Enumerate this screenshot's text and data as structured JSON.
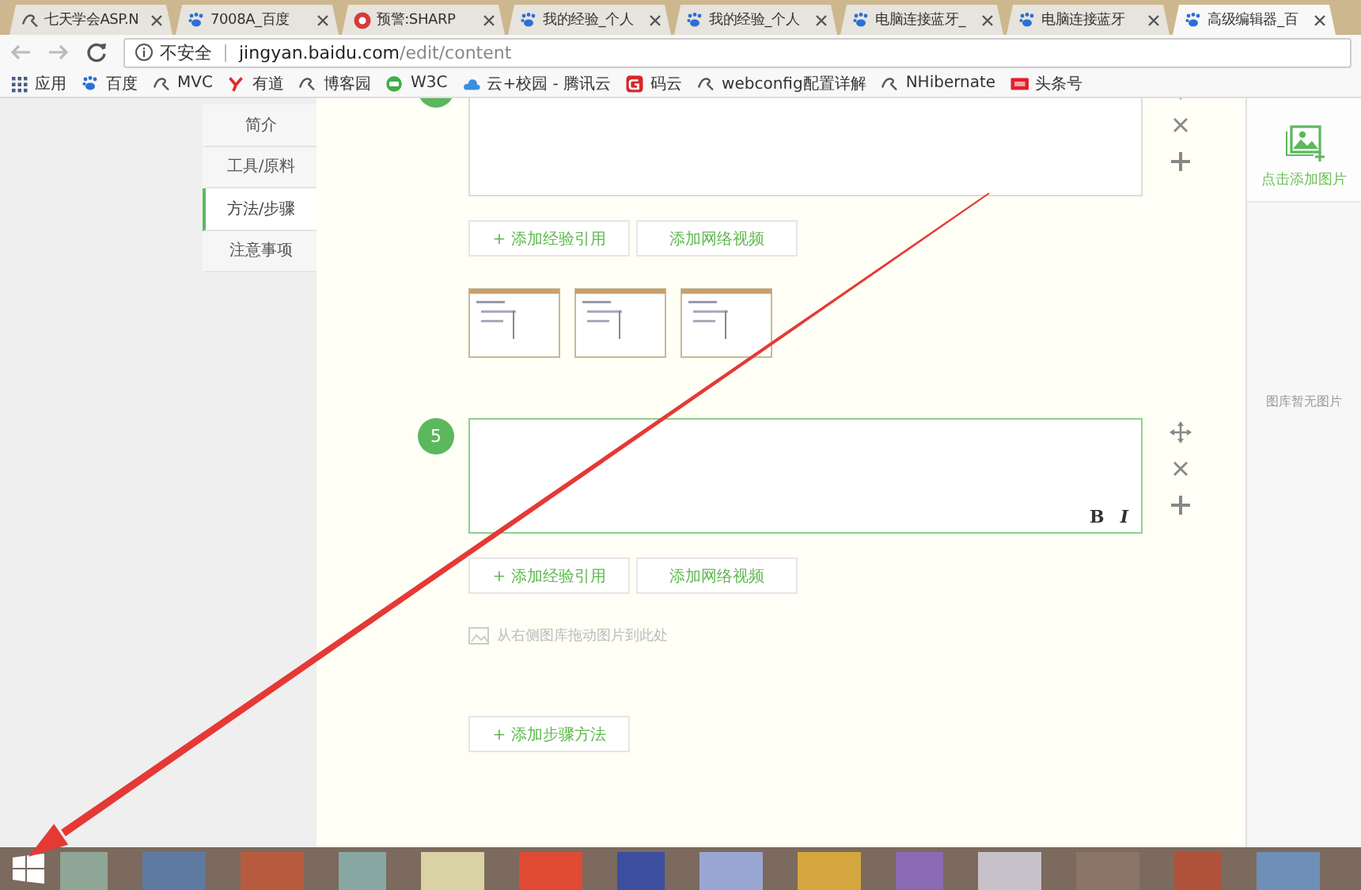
{
  "browser": {
    "tabs": [
      {
        "title": "七天学会ASP.N",
        "kind": "logo",
        "selected": false
      },
      {
        "title": "7008A_百度",
        "kind": "paw",
        "selected": false
      },
      {
        "title": "预警:SHARP",
        "kind": "alert",
        "selected": false
      },
      {
        "title": "我的经验_个人",
        "kind": "paw",
        "selected": false
      },
      {
        "title": "我的经验_个人",
        "kind": "paw",
        "selected": false
      },
      {
        "title": "电脑连接蓝牙_",
        "kind": "paw",
        "selected": false
      },
      {
        "title": "电脑连接蓝牙",
        "kind": "paw",
        "selected": false
      },
      {
        "title": "高级编辑器_百",
        "kind": "paw",
        "selected": true
      }
    ],
    "address": {
      "security": "不安全",
      "host": "jingyan.baidu.com",
      "path": "/edit/content"
    },
    "bookmarks": [
      {
        "label": "应用",
        "kind": "apps"
      },
      {
        "label": "百度",
        "kind": "paw"
      },
      {
        "label": "MVC",
        "kind": "logo"
      },
      {
        "label": "有道",
        "kind": "youdao"
      },
      {
        "label": "博客园",
        "kind": "logo"
      },
      {
        "label": "W3C",
        "kind": "w3c"
      },
      {
        "label": "云+校园 - 腾讯云",
        "kind": "cloud"
      },
      {
        "label": "码云",
        "kind": "gitee"
      },
      {
        "label": "webconfig配置详解",
        "kind": "logo"
      },
      {
        "label": "NHibernate",
        "kind": "logo"
      },
      {
        "label": "头条号",
        "kind": "toutiao"
      }
    ]
  },
  "sidebar": {
    "items": [
      {
        "label": "简介",
        "selected": false
      },
      {
        "label": "工具/原料",
        "selected": false
      },
      {
        "label": "方法/步骤",
        "selected": true
      },
      {
        "label": "注意事项",
        "selected": false
      }
    ]
  },
  "editor": {
    "steps": [
      {
        "focused": false,
        "buttons": [
          "+ 添加经验引用",
          "添加网络视频"
        ],
        "images": [
          {
            "kind": "screenshot"
          },
          {
            "kind": "screenshot"
          },
          {
            "kind": "screenshot"
          }
        ]
      },
      {
        "number": "5",
        "focused": true,
        "format_buttons": [
          "B",
          "I"
        ],
        "buttons": [
          "+ 添加经验引用",
          "添加网络视频"
        ],
        "drop_hint": "从右侧图库拖动图片到此处"
      }
    ],
    "add_step_button": "+ 添加步骤方法"
  },
  "gallery": {
    "add_label": "点击添加图片",
    "empty_text": "图库暂无图片"
  }
}
